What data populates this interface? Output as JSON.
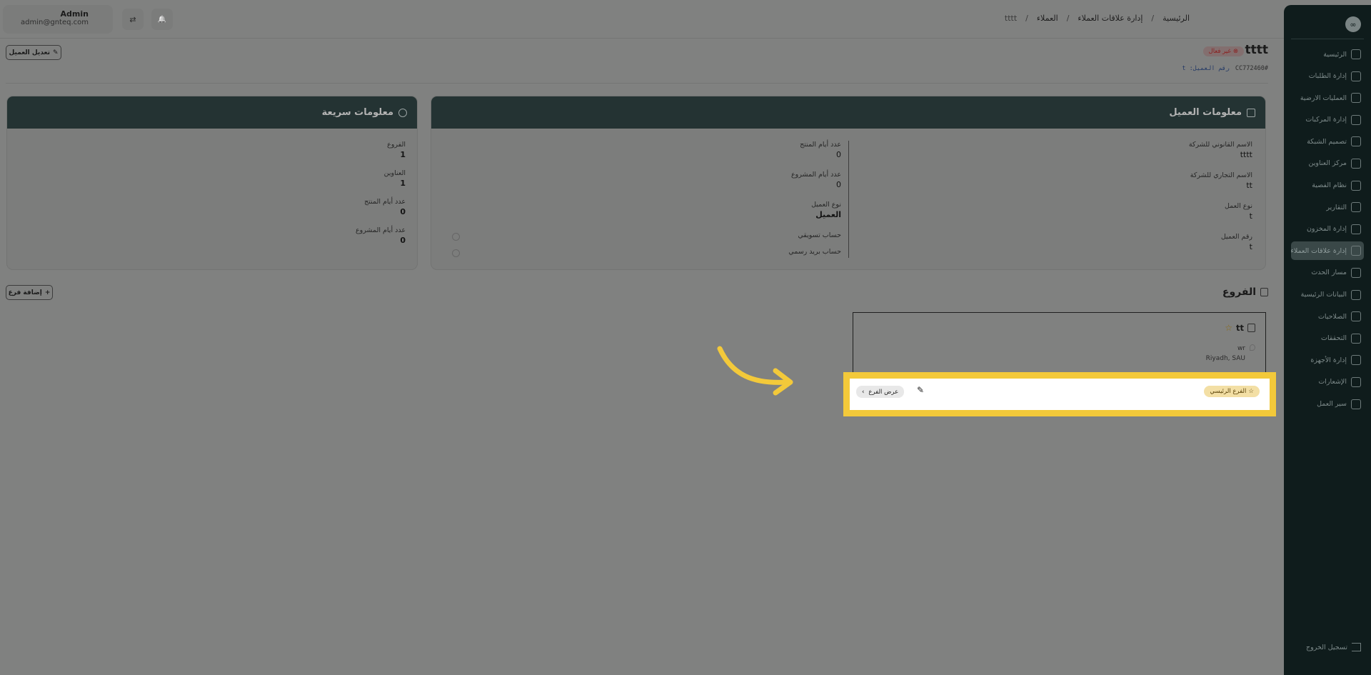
{
  "sidebar": {
    "logo_glyph": "∞",
    "items": [
      {
        "label": "الرئيسية",
        "icon": "dashboard-icon"
      },
      {
        "label": "إدارة الطلبات",
        "icon": "orders-icon"
      },
      {
        "label": "العمليات الارضية",
        "icon": "ground-ops-icon"
      },
      {
        "label": "إدارة المركبات",
        "icon": "truck-icon"
      },
      {
        "label": "تصميم الشبكة",
        "icon": "network-icon"
      },
      {
        "label": "مركز العناوين",
        "icon": "address-icon"
      },
      {
        "label": "نظام الفصية",
        "icon": "sorting-icon"
      },
      {
        "label": "التقارير",
        "icon": "reports-icon"
      },
      {
        "label": "إدارة المخزون",
        "icon": "inventory-icon"
      },
      {
        "label": "إدارة علاقات العملاء",
        "icon": "crm-icon",
        "active": true
      },
      {
        "label": "مسار الحدث",
        "icon": "route-icon"
      },
      {
        "label": "البيانات الرئيسية",
        "icon": "database-icon"
      },
      {
        "label": "الصلاحيات",
        "icon": "users-icon"
      },
      {
        "label": "التحققات",
        "icon": "tools-icon"
      },
      {
        "label": "إدارة الأجهزة",
        "icon": "devices-icon"
      },
      {
        "label": "الإشعارات",
        "icon": "bell-icon"
      },
      {
        "label": "سير العمل",
        "icon": "workflow-icon"
      }
    ],
    "logout_label": "تسجيل الخروج"
  },
  "topbar": {
    "user_name": "Admin",
    "user_email": "admin@gnteq.com",
    "translate_glyph": "⇄",
    "bell_glyph": "🔔",
    "breadcrumb": [
      "الرئيسية",
      "إدارة علاقات العملاء",
      "العملاء",
      "tttt"
    ],
    "separator": "/"
  },
  "header": {
    "title": "tttt",
    "status": "غير فعال",
    "status_glyph": "⊗",
    "id_label": "رقم العميل: t",
    "id_value": "#CC772460",
    "edit_label": "تعديل العميل",
    "edit_glyph": "✎"
  },
  "info_card": {
    "title": "معلومات العميل",
    "right_fields": [
      {
        "label": "الاسم القانوني للشركة",
        "value": "tttt"
      },
      {
        "label": "الاسم التجاري للشركة",
        "value": "tt"
      },
      {
        "label": "نوع العمل",
        "value": "t"
      },
      {
        "label": "رقم العميل",
        "value": "t"
      }
    ],
    "left_fields": [
      {
        "label": "عدد أيام المنتج",
        "value": "0"
      },
      {
        "label": "عدد أيام المشروع",
        "value": "0"
      },
      {
        "label": "نوع العميل",
        "value": "العميل"
      },
      {
        "label": "حساب تسويقي",
        "value": ""
      },
      {
        "label": "حساب بريد رسمي",
        "value": ""
      }
    ]
  },
  "quick_card": {
    "title": "معلومات سريعة",
    "fields": [
      {
        "label": "الفروع",
        "value": "1"
      },
      {
        "label": "العناوين",
        "value": "1"
      },
      {
        "label": "عدد أيام المنتج",
        "value": "0"
      },
      {
        "label": "عدد أيام المشروع",
        "value": "0"
      }
    ]
  },
  "branches": {
    "title": "الفروع",
    "add_label": "إضافة فرع",
    "add_glyph": "+",
    "card": {
      "name": "tt",
      "star_glyph": "☆",
      "address_line1": "wr",
      "address_line2": "Riyadh, SAU",
      "main_tag": "الفرع الرئيسي",
      "view_label": "عرض الفرع",
      "view_glyph": "›",
      "edit_glyph": "✎"
    }
  },
  "colors": {
    "highlight": "#f3c93a",
    "sidebar": "#0f1c1c",
    "card_header": "#243333",
    "status_red": "#8b1e1e",
    "main_tag_bg": "#f3dfa5"
  }
}
